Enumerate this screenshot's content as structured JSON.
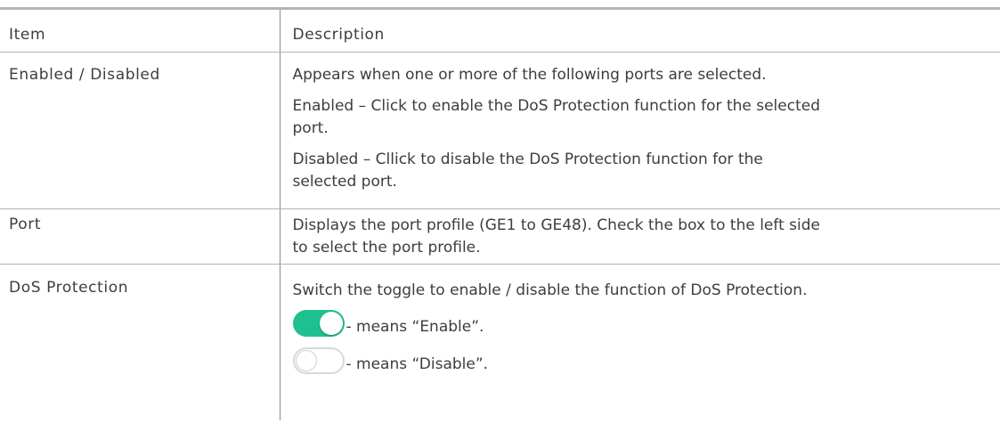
{
  "table": {
    "header": {
      "item": "Item",
      "description": "Description"
    },
    "rows": {
      "enabled": {
        "item": "Enabled / Disabled",
        "desc1": "Appears when one or more of the following ports are selected.",
        "desc2a": "Enabled – Click to enable the DoS Protection function for the selected",
        "desc2b": "port.",
        "desc3a": "Disabled – Cllick to disable the DoS Protection function for the",
        "desc3b": "selected port."
      },
      "port": {
        "item": "Port",
        "desc1a": "Displays the port profile (GE1 to GE48). Check the box to the left side",
        "desc1b": "to select the port profile."
      },
      "dos": {
        "item": "DoS Protection",
        "desc1": "Switch the toggle to enable / disable the function of DoS Protection.",
        "enable_text": "- means “Enable”.",
        "disable_text": "- means “Disable”.",
        "toggle_on_color": "#1fc08f",
        "toggle_off_color": "#d8d8d8"
      }
    }
  }
}
